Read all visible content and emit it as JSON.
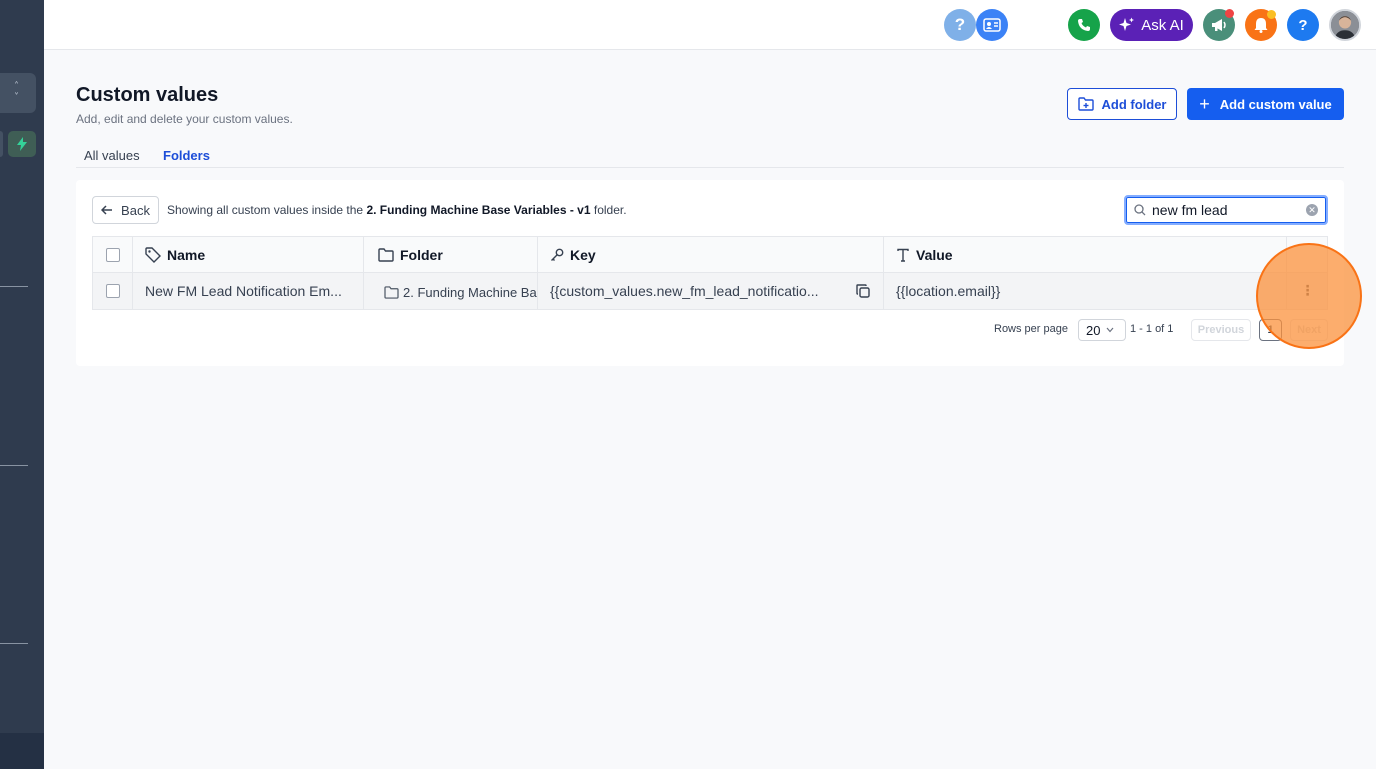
{
  "topbar": {
    "ask_ai_label": "Ask AI",
    "help_glyph": "?",
    "support_glyph": "?"
  },
  "header": {
    "title": "Custom values",
    "subtitle": "Add, edit and delete your custom values.",
    "add_folder_label": "Add folder",
    "add_custom_value_label": "Add custom value"
  },
  "tabs": [
    {
      "label": "All values",
      "active": false
    },
    {
      "label": "Folders",
      "active": true
    }
  ],
  "toolbar": {
    "back_label": "Back",
    "showing_prefix": "Showing all custom values inside the ",
    "folder_name": "2. Funding Machine Base Variables - v1",
    "showing_suffix": " folder."
  },
  "search": {
    "value": "new fm lead",
    "placeholder": "Search"
  },
  "table": {
    "columns": [
      "Name",
      "Folder",
      "Key",
      "Value"
    ],
    "rows": [
      {
        "name": "New FM Lead Notification Em...",
        "folder": "2. Funding Machine Ba",
        "key": "{{custom_values.new_fm_lead_notificatio...",
        "value": "{{location.email}}"
      }
    ]
  },
  "pagination": {
    "rows_per_page_label": "Rows per page",
    "rows_per_page": "20",
    "range": "1 - 1 of 1",
    "previous_label": "Previous",
    "current_page": "1",
    "next_label": "Next"
  },
  "colors": {
    "sidebar": "#2f3b4e",
    "primary": "#155eef",
    "ask_ai": "#5b21b6",
    "phone": "#16a34a",
    "notification": "#f97316",
    "highlight": "#fb923c"
  },
  "icons": [
    "switcher-chevrons-icon",
    "bolt-icon",
    "help-circle-icon",
    "contact-card-icon",
    "phone-icon",
    "sparkle-icon",
    "megaphone-icon",
    "bell-icon",
    "question-icon",
    "avatar",
    "folder-plus-icon",
    "plus-icon",
    "arrow-left-icon",
    "search-icon",
    "clear-icon",
    "tag-icon",
    "folder-icon",
    "key-icon",
    "text-icon",
    "copy-icon",
    "kebab-icon",
    "chevron-down-icon"
  ]
}
